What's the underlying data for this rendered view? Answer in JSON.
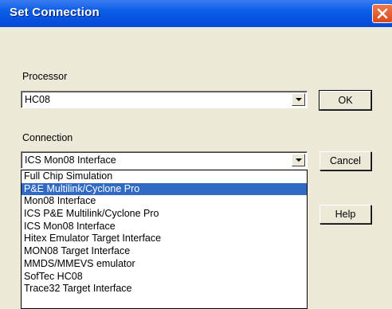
{
  "window": {
    "title": "Set Connection"
  },
  "processor": {
    "label": "Processor",
    "value": "HC08"
  },
  "connection": {
    "label": "Connection",
    "value": "ICS Mon08 Interface",
    "options": [
      "Full Chip Simulation",
      "P&E Multilink/Cyclone Pro",
      "Mon08 Interface",
      "ICS P&E Multilink/Cyclone Pro",
      "ICS Mon08 Interface",
      "Hitex Emulator Target Interface",
      "MON08 Target Interface",
      "MMDS/MMEVS emulator",
      "SofTec HC08",
      "Trace32 Target Interface"
    ],
    "highlighted_index": 1
  },
  "buttons": {
    "ok": "OK",
    "cancel": "Cancel",
    "help": "Help"
  },
  "icons": {
    "close": "close-icon",
    "dropdown": "chevron-down-icon"
  }
}
